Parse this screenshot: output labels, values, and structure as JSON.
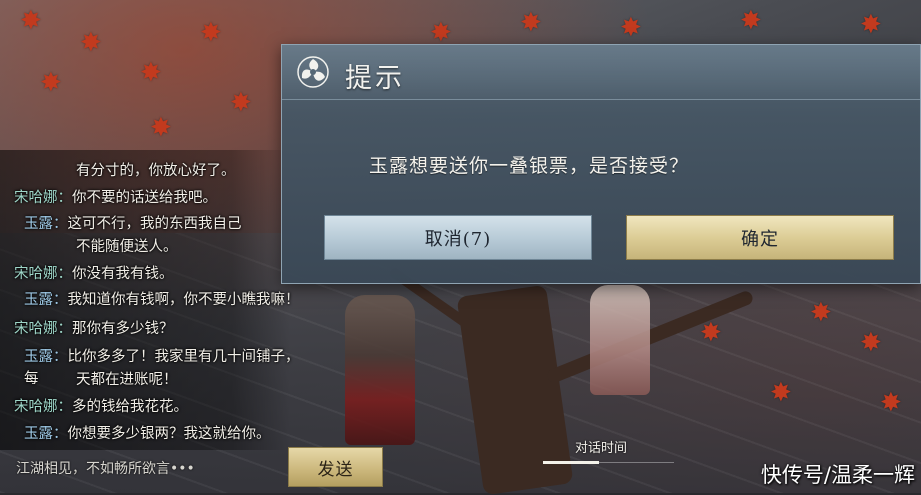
{
  "dialog": {
    "title": "提示",
    "message": "玉露想要送你一叠银票，是否接受？",
    "cancel_label": "取消(7)",
    "confirm_label": "确定",
    "icon": "swirl-emblem-icon"
  },
  "chat": {
    "lines": [
      {
        "speaker": "",
        "text": "有分寸的，你放心好了。"
      },
      {
        "speaker": "宋哈娜：",
        "text": "你不要的话送给我吧。"
      },
      {
        "speaker": "玉露：",
        "text": "这可不行，我的东西我自己"
      },
      {
        "speaker": "",
        "text": "不能随便送人。"
      },
      {
        "speaker": "宋哈娜：",
        "text": "你没有我有钱。"
      },
      {
        "speaker": "玉露：",
        "text": "我知道你有钱啊，你不要小瞧我嘛！"
      },
      {
        "speaker": "宋哈娜：",
        "text": "那你有多少钱？"
      },
      {
        "speaker": "玉露：",
        "text": "比你多多了！我家里有几十间铺子，每"
      },
      {
        "speaker": "",
        "text": "天都在进账呢！"
      },
      {
        "speaker": "宋哈娜：",
        "text": "多的钱给我花花。"
      },
      {
        "speaker": "玉露：",
        "text": "你想要多少银两？我这就给你。"
      }
    ],
    "input_placeholder": "江湖相见，不如畅所欲言•••",
    "send_label": "发送",
    "tab_label": "对话时间"
  },
  "watermark": "快传号/温柔一辉",
  "colors": {
    "speaker_song": "#9ed6c8",
    "speaker_yulu": "#9ec9e6",
    "confirm_gold": "#dccd96",
    "cancel_blue": "#b9ccd8"
  }
}
